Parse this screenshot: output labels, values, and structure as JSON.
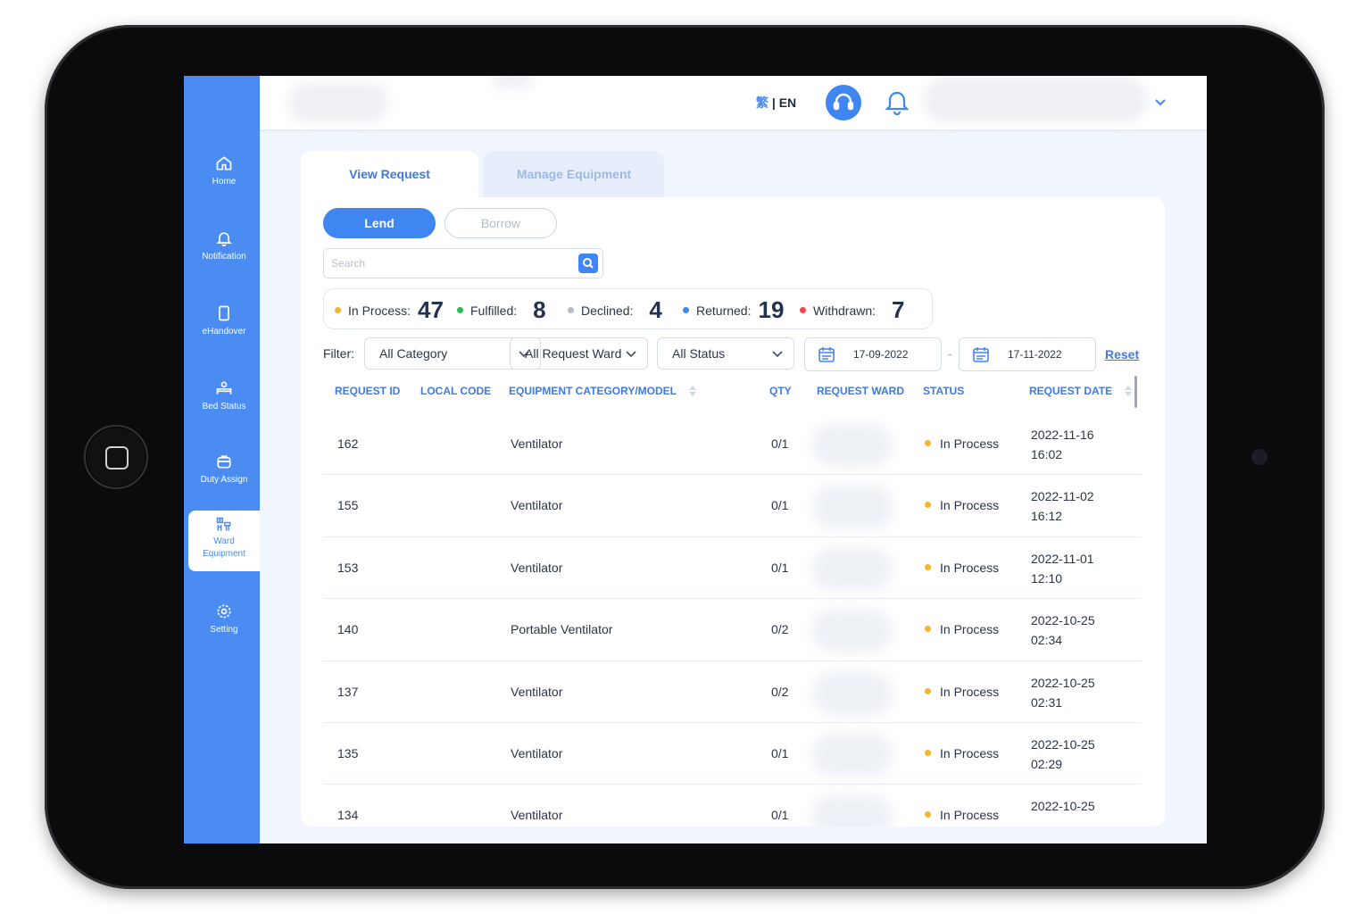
{
  "sidebar": {
    "items": [
      {
        "label": "Home",
        "icon": "home-icon"
      },
      {
        "label": "Notification",
        "icon": "bell-icon"
      },
      {
        "label": "eHandover",
        "icon": "tablet-icon"
      },
      {
        "label": "Bed Status",
        "icon": "bed-icon"
      },
      {
        "label": "Duty Assign",
        "icon": "briefcase-icon"
      },
      {
        "label": "Ward",
        "label2": "Equipment",
        "icon": "equipment-icon",
        "active": true
      },
      {
        "label": "Setting",
        "icon": "gear-icon"
      }
    ]
  },
  "header": {
    "lang_zh": "繁",
    "lang_sep": " | ",
    "lang_en": "EN"
  },
  "tabs": [
    {
      "label": "View Request",
      "active": true
    },
    {
      "label": "Manage Equipment",
      "active": false
    }
  ],
  "toggle": {
    "lend": "Lend",
    "borrow": "Borrow"
  },
  "search": {
    "placeholder": "Search"
  },
  "stats": [
    {
      "label": "In Process:",
      "value": "47",
      "color": "#f5b52a"
    },
    {
      "label": "Fulfilled:",
      "value": "8",
      "color": "#2fb553"
    },
    {
      "label": "Declined:",
      "value": "4",
      "color": "#b8bcc4"
    },
    {
      "label": "Returned:",
      "value": "19",
      "color": "#3f86f2"
    },
    {
      "label": "Withdrawn:",
      "value": "7",
      "color": "#ee4b4b"
    }
  ],
  "filters": {
    "label": "Filter:",
    "category": "All Category",
    "ward": "All Request Ward",
    "status": "All Status",
    "date_from": "17-09-2022",
    "date_to": "17-11-2022",
    "date_sep": "-",
    "reset": "Reset"
  },
  "table": {
    "headers": [
      "REQUEST ID",
      "LOCAL CODE",
      "EQUIPMENT CATEGORY/MODEL",
      "QTY",
      "REQUEST WARD",
      "STATUS",
      "REQUEST DATE"
    ],
    "rows": [
      {
        "id": "162",
        "model": "Ventilator",
        "qty": "0/1",
        "status": "In Process",
        "date": "2022-11-16",
        "time": "16:02"
      },
      {
        "id": "155",
        "model": "Ventilator",
        "qty": "0/1",
        "status": "In Process",
        "date": "2022-11-02",
        "time": "16:12"
      },
      {
        "id": "153",
        "model": "Ventilator",
        "qty": "0/1",
        "status": "In Process",
        "date": "2022-11-01",
        "time": "12:10"
      },
      {
        "id": "140",
        "model": "Portable Ventilator",
        "qty": "0/2",
        "status": "In Process",
        "date": "2022-10-25",
        "time": "02:34"
      },
      {
        "id": "137",
        "model": "Ventilator",
        "qty": "0/2",
        "status": "In Process",
        "date": "2022-10-25",
        "time": "02:31"
      },
      {
        "id": "135",
        "model": "Ventilator",
        "qty": "0/1",
        "status": "In Process",
        "date": "2022-10-25",
        "time": "02:29"
      },
      {
        "id": "134",
        "model": "Ventilator",
        "qty": "0/1",
        "status": "In Process",
        "date": "2022-10-25",
        "time": ""
      }
    ]
  },
  "colors": {
    "accent": "#3f86f2",
    "sidebar": "#4a8cf2",
    "header_text": "#3d7be0",
    "in_process": "#f5b52a"
  }
}
